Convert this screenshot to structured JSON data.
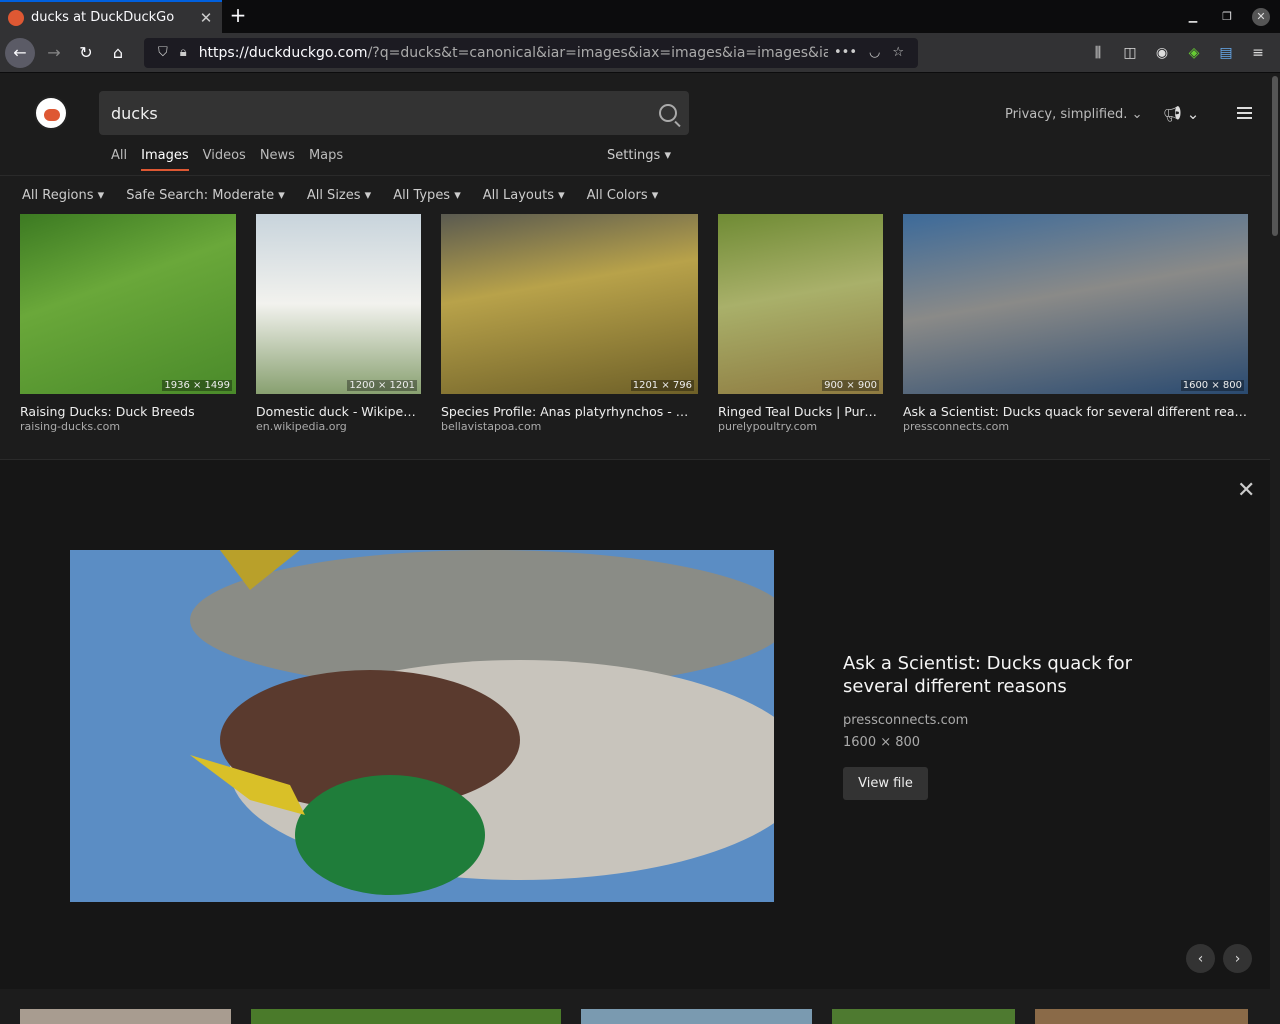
{
  "browser": {
    "tab_title": "ducks at DuckDuckGo",
    "url_main": "https://duckduckgo.com",
    "url_rest": "/?q=ducks&t=canonical&iar=images&iax=images&ia=images&iai=h",
    "newtab_icon": "+",
    "tab_close_icon": "✕"
  },
  "ddg": {
    "search_value": "ducks",
    "tagline": "Privacy, simplified.",
    "tabs": [
      "All",
      "Images",
      "Videos",
      "News",
      "Maps"
    ],
    "settings_label": "Settings",
    "filters": [
      "All Regions",
      "Safe Search: Moderate",
      "All Sizes",
      "All Types",
      "All Layouts",
      "All Colors"
    ]
  },
  "results": [
    {
      "title": "Raising Ducks: Duck Breeds",
      "source": "raising-ducks.com",
      "dims": "1936 × 1499"
    },
    {
      "title": "Domestic duck - Wikipedia",
      "source": "en.wikipedia.org",
      "dims": "1200 × 1201"
    },
    {
      "title": "Species Profile: Anas platyrhynchos - Mall...",
      "source": "bellavistapoa.com",
      "dims": "1201 × 796"
    },
    {
      "title": "Ringed Teal Ducks | Purely...",
      "source": "purelypoultry.com",
      "dims": "900 × 900"
    },
    {
      "title": "Ask a Scientist: Ducks quack for several different reasons",
      "source": "pressconnects.com",
      "dims": "1600 × 800"
    }
  ],
  "detail": {
    "title": "Ask a Scientist: Ducks quack for several different reasons",
    "source": "pressconnects.com",
    "dims": "1600 × 800",
    "view_label": "View file"
  },
  "colors": {
    "accent": "#de5833",
    "bg": "#1c1c1c"
  }
}
